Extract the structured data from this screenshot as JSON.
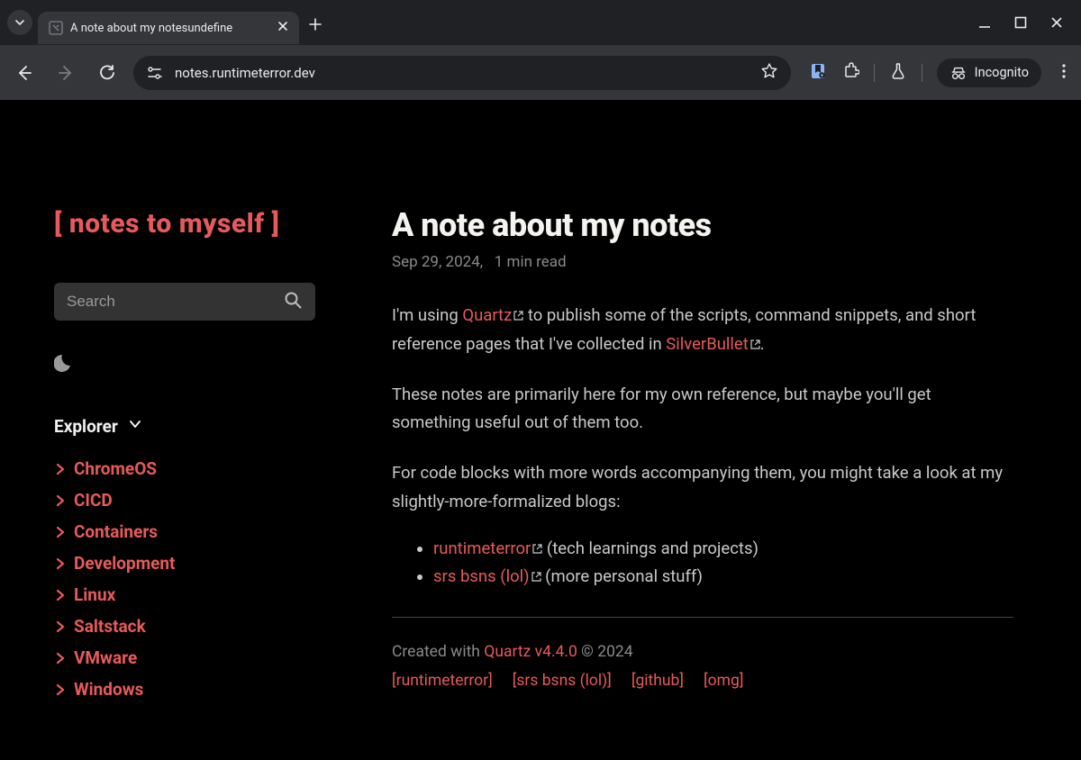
{
  "browser": {
    "tab_title": "A note about my notesundefine",
    "url": "notes.runtimeterror.dev",
    "incognito_label": "Incognito"
  },
  "sidebar": {
    "site_title": "[ notes to myself ]",
    "search_placeholder": "Search",
    "explorer_label": "Explorer",
    "items": [
      {
        "label": "ChromeOS"
      },
      {
        "label": "CICD"
      },
      {
        "label": "Containers"
      },
      {
        "label": "Development"
      },
      {
        "label": "Linux"
      },
      {
        "label": "Saltstack"
      },
      {
        "label": "VMware"
      },
      {
        "label": "Windows"
      }
    ]
  },
  "article": {
    "title": "A note about my notes",
    "date": "Sep 29, 2024,",
    "read_time": "1 min read",
    "p1_a": "I'm using ",
    "link_quartz": "Quartz",
    "p1_b": " to publish some of the scripts, command snippets, and short reference pages that I've collected in ",
    "link_silverbullet": "SilverBullet",
    "p1_c": ".",
    "p2": "These notes are primarily here for my own reference, but maybe you'll get something useful out of them too.",
    "p3": "For code blocks with more words accompanying them, you might take a look at my slightly-more-formalized blogs:",
    "blogs": [
      {
        "name": "runtimeterror",
        "aside": " (tech learnings and projects)"
      },
      {
        "name": "srs bsns (lol)",
        "aside": " (more personal stuff)"
      }
    ]
  },
  "footer": {
    "created_a": "Created with ",
    "quartz_version": "Quartz v4.4.0",
    "created_b": " © 2024",
    "links": [
      "[runtimeterror]",
      "[srs bsns (lol)]",
      "[github]",
      "[omg]"
    ]
  }
}
